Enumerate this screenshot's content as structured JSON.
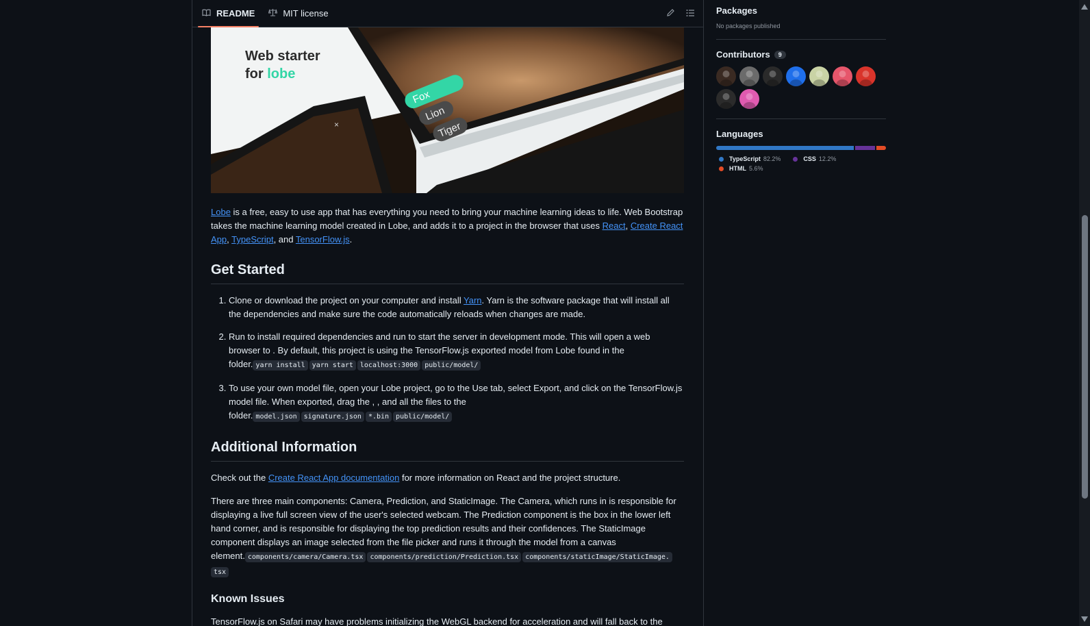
{
  "readme_header": {
    "tabs": [
      {
        "label": "README",
        "icon": "book-icon"
      },
      {
        "label": "MIT license",
        "icon": "law-icon"
      }
    ],
    "actions": [
      {
        "icon": "pencil-icon"
      },
      {
        "icon": "list-unordered-icon"
      }
    ]
  },
  "hero": {
    "title_line1": "Web starter",
    "title_line2_prefix": "for ",
    "title_line2_brand": "lobe",
    "chips": [
      "Fox",
      "Lion",
      "Tiger"
    ],
    "close_glyph": "×",
    "colors": {
      "brand": "#33d6a6",
      "tablet": "#f2f4f4"
    }
  },
  "intro": {
    "link_lobe": "Lobe",
    "text1": " is a free, easy to use app that has everything you need to bring your machine learning ideas to life. Web Bootstrap takes the machine learning model created in Lobe, and adds it to a project in the browser that uses ",
    "link_react": "React",
    "sep1": ", ",
    "link_cra": "Create React App",
    "sep2": ", ",
    "link_ts": "TypeScript",
    "sep3": ", and ",
    "link_tfjs": "TensorFlow.js",
    "end": "."
  },
  "get_started": {
    "heading": "Get Started",
    "step1": {
      "text1": "Clone or download the project on your computer and install ",
      "link": "Yarn",
      "text2": ". Yarn is the software package that will install all the dependencies and make sure the code automatically reloads when changes are made."
    },
    "step2": {
      "text": "Run to install required dependencies and run to start the server in development mode. This will open a web browser to . By default, this project is using the TensorFlow.js exported model from Lobe found in the folder.",
      "codes": [
        "yarn install",
        "yarn start",
        "localhost:3000",
        "public/model/"
      ]
    },
    "step3": {
      "text": "To use your own model file, open your Lobe project, go to the Use tab, select Export, and click on the TensorFlow.js model file. When exported, drag the , , and all the files to the folder.",
      "codes": [
        "model.json",
        "signature.json",
        "*.bin",
        "public/model/"
      ]
    }
  },
  "additional": {
    "heading": "Additional Information",
    "p1_prefix": "Check out the ",
    "p1_link": "Create React App documentation",
    "p1_suffix": " for more information on React and the project structure.",
    "p2": "There are three main components: Camera, Prediction, and StaticImage. The Camera, which runs in is responsible for displaying a live full screen view of the user's selected webcam. The Prediction component is the box in the lower left hand corner, and is responsible for displaying the top prediction results and their confidences. The StaticImage component displays an image selected from the file picker and runs it through the model from a canvas element.",
    "p2_codes": [
      "components/camera/Camera.tsx",
      "components/prediction/Prediction.tsx",
      "components/staticImage/StaticImage.",
      "tsx"
    ]
  },
  "known_issues": {
    "heading": "Known Issues",
    "p1": "TensorFlow.js on Safari may have problems initializing the WebGL backend for acceleration and will fall back to the"
  },
  "sidebar": {
    "packages": {
      "title": "Packages",
      "empty": "No packages published"
    },
    "contributors": {
      "title": "Contributors",
      "count": "9",
      "avatar_colors": [
        "#3a2a22",
        "#6b6b6b",
        "#2a2a2a",
        "#1f6feb",
        "#c9d3a5",
        "#e6566b",
        "#d9342b",
        "#2b2b2b",
        "#e05bb0"
      ]
    },
    "languages": {
      "title": "Languages",
      "items": [
        {
          "name": "TypeScript",
          "pct": "82.2%",
          "value": 82.2,
          "color": "#3178c6"
        },
        {
          "name": "CSS",
          "pct": "12.2%",
          "value": 12.2,
          "color": "#663399"
        },
        {
          "name": "HTML",
          "pct": "5.6%",
          "value": 5.6,
          "color": "#e34c26"
        }
      ]
    }
  }
}
